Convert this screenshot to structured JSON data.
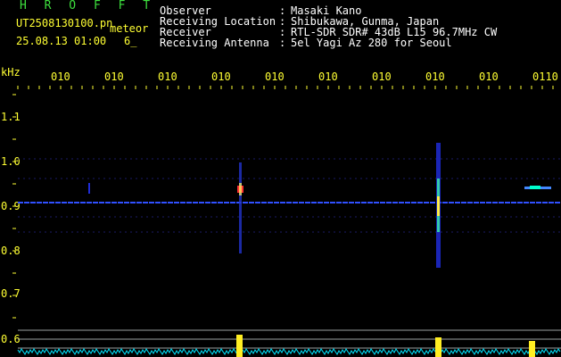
{
  "header": {
    "logo": "H R O F F T",
    "filename": "UT2508130100.pn",
    "meteor_label": "meteor",
    "datetime": "25.08.13 01:00",
    "count": "6_",
    "fields": [
      {
        "label": "Observer",
        "value": "Masaki Kano"
      },
      {
        "label": "Receiving Location",
        "value": "Shibukawa, Gunma, Japan"
      },
      {
        "label": "Receiver",
        "value": "RTL-SDR SDR# 43dB L15 96.7MHz CW"
      },
      {
        "label": "Receiving Antenna",
        "value": "5el Yagi Az 280 for Seoul"
      }
    ],
    "separator": ":"
  },
  "axis": {
    "unit": "kHz",
    "time_labels": [
      "010",
      "010",
      "010",
      "010",
      "010",
      "010",
      "010",
      "010",
      "010",
      "0110"
    ],
    "freq_labels": [
      "1.1",
      "1.0",
      "0.9",
      "0.8",
      "0.7",
      "0.6"
    ]
  },
  "colors": {
    "background": "#000000",
    "text": "#ffffff",
    "accent": "#ffff33",
    "logo": "#3ee03e",
    "carrier": "#3050ff",
    "grid": "#1a1a66",
    "noise": "#00e5ff"
  }
}
